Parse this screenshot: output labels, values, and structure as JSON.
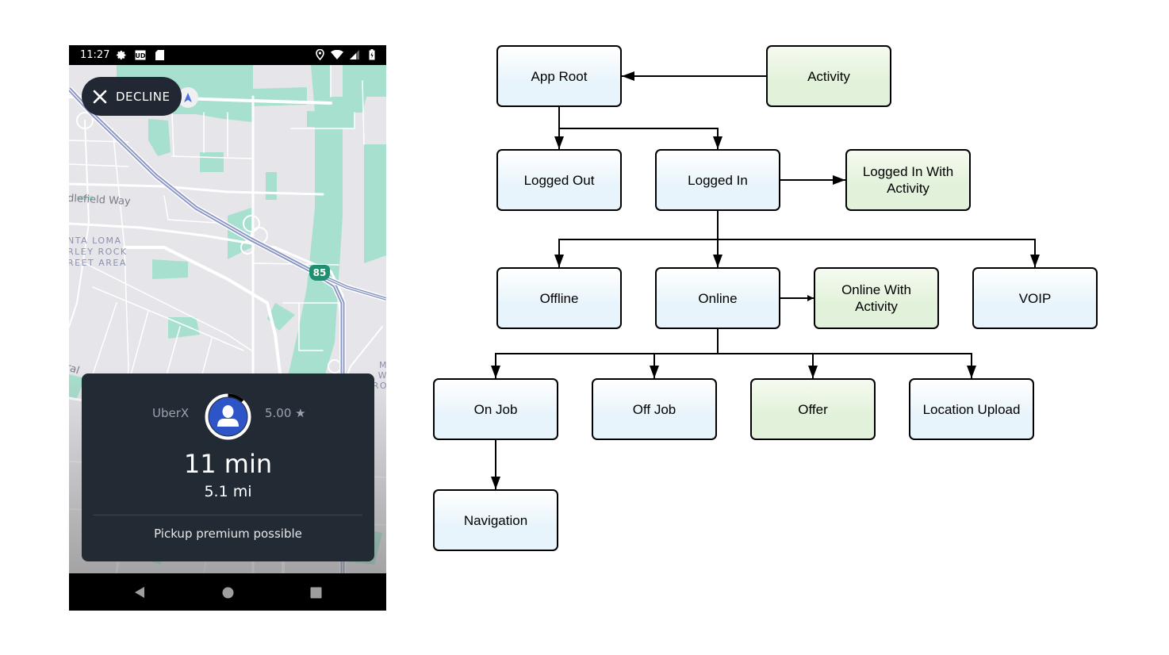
{
  "phone": {
    "status_bar": {
      "time": "11:27",
      "left_icons": [
        "gear-icon",
        "ud-app-icon",
        "sd-card-icon"
      ],
      "right_icons": [
        "location-pin-icon",
        "wifi-icon",
        "cell-signal-icon",
        "battery-charging-icon"
      ]
    },
    "decline_button": {
      "label": "DECLINE",
      "icon": "close-icon"
    },
    "map": {
      "street_label": "dlefield Way",
      "area_label_lines": [
        "NTA LOMA",
        "RLEY ROCK",
        "REET AREA"
      ],
      "area_label_right_lines": [
        "M",
        "W",
        "RO"
      ],
      "road_label": "ral",
      "highway_shield": "85",
      "colors": {
        "land": "#e5e5ea",
        "park": "#a8e0cf",
        "highway": "#8a96c4",
        "road": "#ffffff"
      }
    },
    "offer_card": {
      "vehicle_type": "UberX",
      "rating": "5.00 ★",
      "eta": "11 min",
      "distance": "5.1 mi",
      "note": "Pickup premium possible",
      "timer_elapsed_fraction": 0.12,
      "avatar_color": "#2d55c8"
    },
    "nav_bar": {
      "buttons": [
        "back-icon",
        "home-icon",
        "recents-icon"
      ]
    }
  },
  "diagram": {
    "colors": {
      "state_node": "#e8f4fb",
      "activity_node": "#e2f2da",
      "stroke": "#000000"
    },
    "nodes": [
      {
        "id": "app_root",
        "label": "App Root",
        "kind": "state"
      },
      {
        "id": "activity",
        "label": "Activity",
        "kind": "activity"
      },
      {
        "id": "logged_out",
        "label": "Logged Out",
        "kind": "state"
      },
      {
        "id": "logged_in",
        "label": "Logged In",
        "kind": "state"
      },
      {
        "id": "logged_in_with_activity",
        "label": "Logged In With Activity",
        "kind": "activity"
      },
      {
        "id": "offline",
        "label": "Offline",
        "kind": "state"
      },
      {
        "id": "online",
        "label": "Online",
        "kind": "state"
      },
      {
        "id": "online_with_activity",
        "label": "Online With Activity",
        "kind": "activity"
      },
      {
        "id": "voip",
        "label": "VOIP",
        "kind": "state"
      },
      {
        "id": "on_job",
        "label": "On Job",
        "kind": "state"
      },
      {
        "id": "off_job",
        "label": "Off Job",
        "kind": "state"
      },
      {
        "id": "offer",
        "label": "Offer",
        "kind": "activity"
      },
      {
        "id": "location_upload",
        "label": "Location Upload",
        "kind": "state"
      },
      {
        "id": "navigation",
        "label": "Navigation",
        "kind": "state"
      }
    ],
    "edges": [
      {
        "from": "activity",
        "to": "app_root"
      },
      {
        "from": "app_root",
        "to": "logged_out"
      },
      {
        "from": "app_root",
        "to": "logged_in"
      },
      {
        "from": "logged_in",
        "to": "logged_in_with_activity"
      },
      {
        "from": "logged_in",
        "to": "offline"
      },
      {
        "from": "logged_in",
        "to": "online"
      },
      {
        "from": "logged_in",
        "to": "voip"
      },
      {
        "from": "online",
        "to": "online_with_activity"
      },
      {
        "from": "online",
        "to": "on_job"
      },
      {
        "from": "online",
        "to": "off_job"
      },
      {
        "from": "online",
        "to": "offer"
      },
      {
        "from": "online",
        "to": "location_upload"
      },
      {
        "from": "on_job",
        "to": "navigation"
      }
    ]
  }
}
